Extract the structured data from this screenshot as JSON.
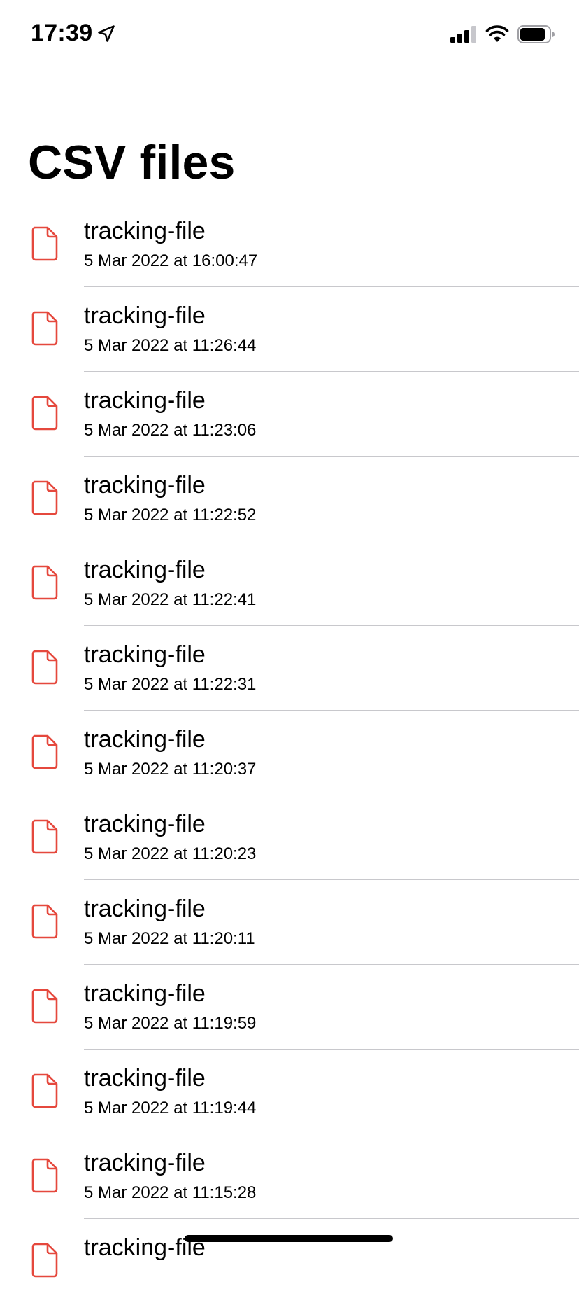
{
  "status_bar": {
    "time": "17:39",
    "location_icon": "location-arrow-icon",
    "signal_icon": "cellular-signal-icon",
    "wifi_icon": "wifi-icon",
    "battery_icon": "battery-icon"
  },
  "page": {
    "title": "CSV files"
  },
  "colors": {
    "accent": "#e5483d",
    "divider": "#c8c8cc",
    "text": "#000000"
  },
  "files": [
    {
      "name": "tracking-file",
      "date": "5 Mar 2022 at 16:00:47",
      "icon": "document-icon"
    },
    {
      "name": "tracking-file",
      "date": "5 Mar 2022 at 11:26:44",
      "icon": "document-icon"
    },
    {
      "name": "tracking-file",
      "date": "5 Mar 2022 at 11:23:06",
      "icon": "document-icon"
    },
    {
      "name": "tracking-file",
      "date": "5 Mar 2022 at 11:22:52",
      "icon": "document-icon"
    },
    {
      "name": "tracking-file",
      "date": "5 Mar 2022 at 11:22:41",
      "icon": "document-icon"
    },
    {
      "name": "tracking-file",
      "date": "5 Mar 2022 at 11:22:31",
      "icon": "document-icon"
    },
    {
      "name": "tracking-file",
      "date": "5 Mar 2022 at 11:20:37",
      "icon": "document-icon"
    },
    {
      "name": "tracking-file",
      "date": "5 Mar 2022 at 11:20:23",
      "icon": "document-icon"
    },
    {
      "name": "tracking-file",
      "date": "5 Mar 2022 at 11:20:11",
      "icon": "document-icon"
    },
    {
      "name": "tracking-file",
      "date": "5 Mar 2022 at 11:19:59",
      "icon": "document-icon"
    },
    {
      "name": "tracking-file",
      "date": "5 Mar 2022 at 11:19:44",
      "icon": "document-icon"
    },
    {
      "name": "tracking-file",
      "date": "5 Mar 2022 at 11:15:28",
      "icon": "document-icon"
    },
    {
      "name": "tracking-file",
      "icon": "document-icon"
    }
  ]
}
